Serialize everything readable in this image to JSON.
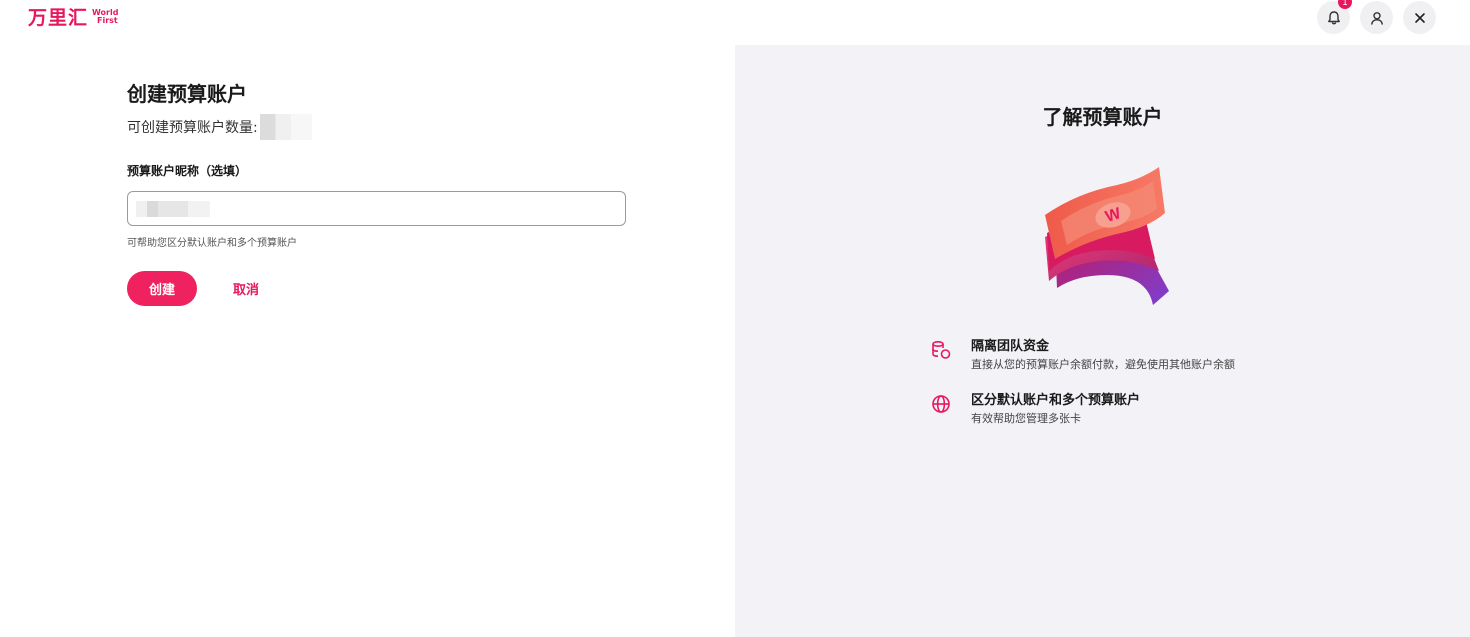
{
  "header": {
    "logo_cn": "万里汇",
    "logo_en_line1": "World",
    "logo_en_line2": "First",
    "notification_count": "1"
  },
  "form": {
    "title": "创建预算账户",
    "quota_label": "可创建预算账户数量:",
    "nickname_label": "预算账户昵称（选填）",
    "hint": "可帮助您区分默认账户和多个预算账户",
    "create_label": "创建",
    "cancel_label": "取消"
  },
  "info": {
    "title": "了解预算账户",
    "features": [
      {
        "icon": "coins-icon",
        "title": "隔离团队资金",
        "desc": "直接从您的预算账户余额付款，避免使用其他账户余额"
      },
      {
        "icon": "globe-icon",
        "title": "区分默认账户和多个预算账户",
        "desc": "有效帮助您管理多张卡"
      }
    ]
  },
  "colors": {
    "brand": "#e8175d",
    "panel_bg": "#f2f2f7"
  }
}
